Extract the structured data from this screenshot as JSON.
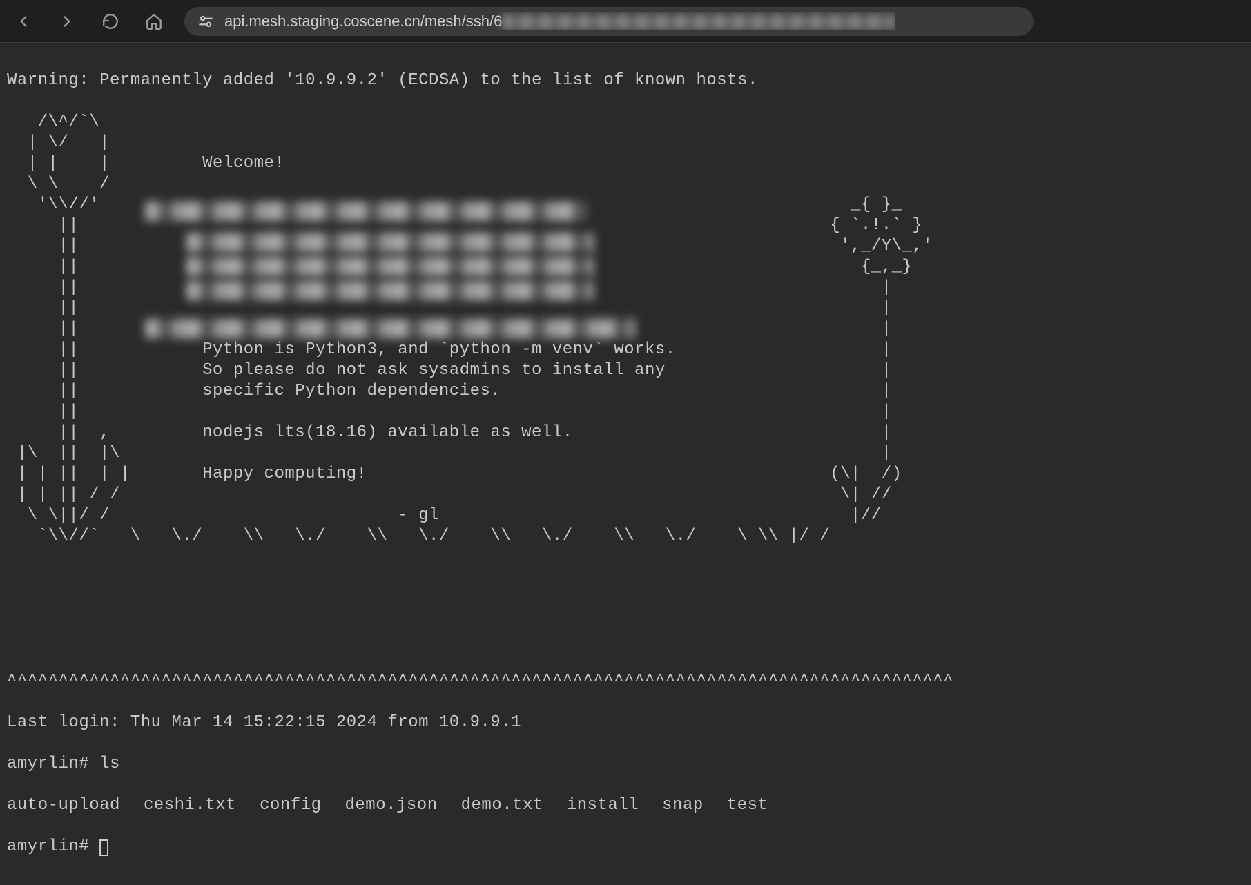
{
  "browser": {
    "url_visible": "api.mesh.staging.coscene.cn/mesh/ssh/6"
  },
  "terminal": {
    "warning": "Warning: Permanently added '10.9.9.2' (ECDSA) to the list of known hosts.",
    "ascii_art": "   /\\^/`\\\n  | \\/   |\n  | |    |         Welcome!\n  \\ \\    /\n   '\\\\//'                                                                         _{ }_\n     ||                                                                         { `.!.` }\n     ||                                                                          ',_/Y\\_,'\n     ||                                                                            {_,_}\n     ||                                                                              |\n     ||                                                                              |\n     ||                                                                              |\n     ||            Python is Python3, and `python -m venv` works.                    |\n     ||            So please do not ask sysadmins to install any                     |\n     ||            specific Python dependencies.                                     |\n     ||                                                                              |\n     ||  ,         nodejs lts(18.16) available as well.                              |\n |\\  ||  |\\                                                                          |\n | | ||  | |       Happy computing!                                             (\\|  /)\n | | || / /                                                                      \\| //\n  \\ \\||/ /                            - gl                                        |//\n   `\\\\//`   \\   \\./    \\\\   \\./    \\\\   \\./    \\\\   \\./    \\\\   \\./    \\ \\\\ |/ /",
    "wave_line": "^^^^^^^^^^^^^^^^^^^^^^^^^^^^^^^^^^^^^^^^^^^^^^^^^^^^^^^^^^^^^^^^^^^^^^^^^^^^^^^^^^^^^^^^^^^^",
    "last_login": "Last login: Thu Mar 14 15:22:15 2024 from 10.9.9.1",
    "prompt1": "amyrlin# ",
    "cmd1": "ls",
    "ls_output": [
      "auto-upload",
      "ceshi.txt",
      "config",
      "demo.json",
      "demo.txt",
      "install",
      "snap",
      "test"
    ],
    "prompt2": "amyrlin# "
  }
}
